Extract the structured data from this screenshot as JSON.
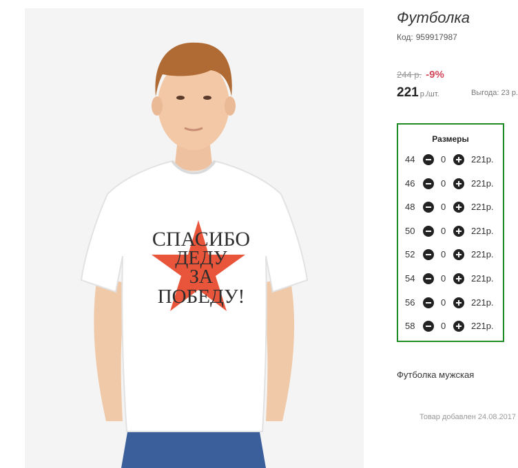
{
  "product": {
    "title": "Футболка",
    "code_label": "Код:",
    "code_value": "959917987",
    "old_price": "244 р.",
    "discount": "-9%",
    "price": "221",
    "price_unit": "р./шт.",
    "savings_label": "Выгода:",
    "savings_value": "23 р."
  },
  "photo": {
    "shirt_print_lines": [
      "СПАСИБО",
      "ДЕДУ",
      "ЗА",
      "ПОБЕДУ!"
    ],
    "star_color": "#e9553a"
  },
  "sizes": {
    "title": "Размеры",
    "rows": [
      {
        "size": "44",
        "qty": "0",
        "price": "221р."
      },
      {
        "size": "46",
        "qty": "0",
        "price": "221р."
      },
      {
        "size": "48",
        "qty": "0",
        "price": "221р."
      },
      {
        "size": "50",
        "qty": "0",
        "price": "221р."
      },
      {
        "size": "52",
        "qty": "0",
        "price": "221р."
      },
      {
        "size": "54",
        "qty": "0",
        "price": "221р."
      },
      {
        "size": "56",
        "qty": "0",
        "price": "221р."
      },
      {
        "size": "58",
        "qty": "0",
        "price": "221р."
      }
    ],
    "border_color": "#1e8c25"
  },
  "description": "Футболка мужская",
  "added_date": "Товар добавлен 24.08.2017"
}
